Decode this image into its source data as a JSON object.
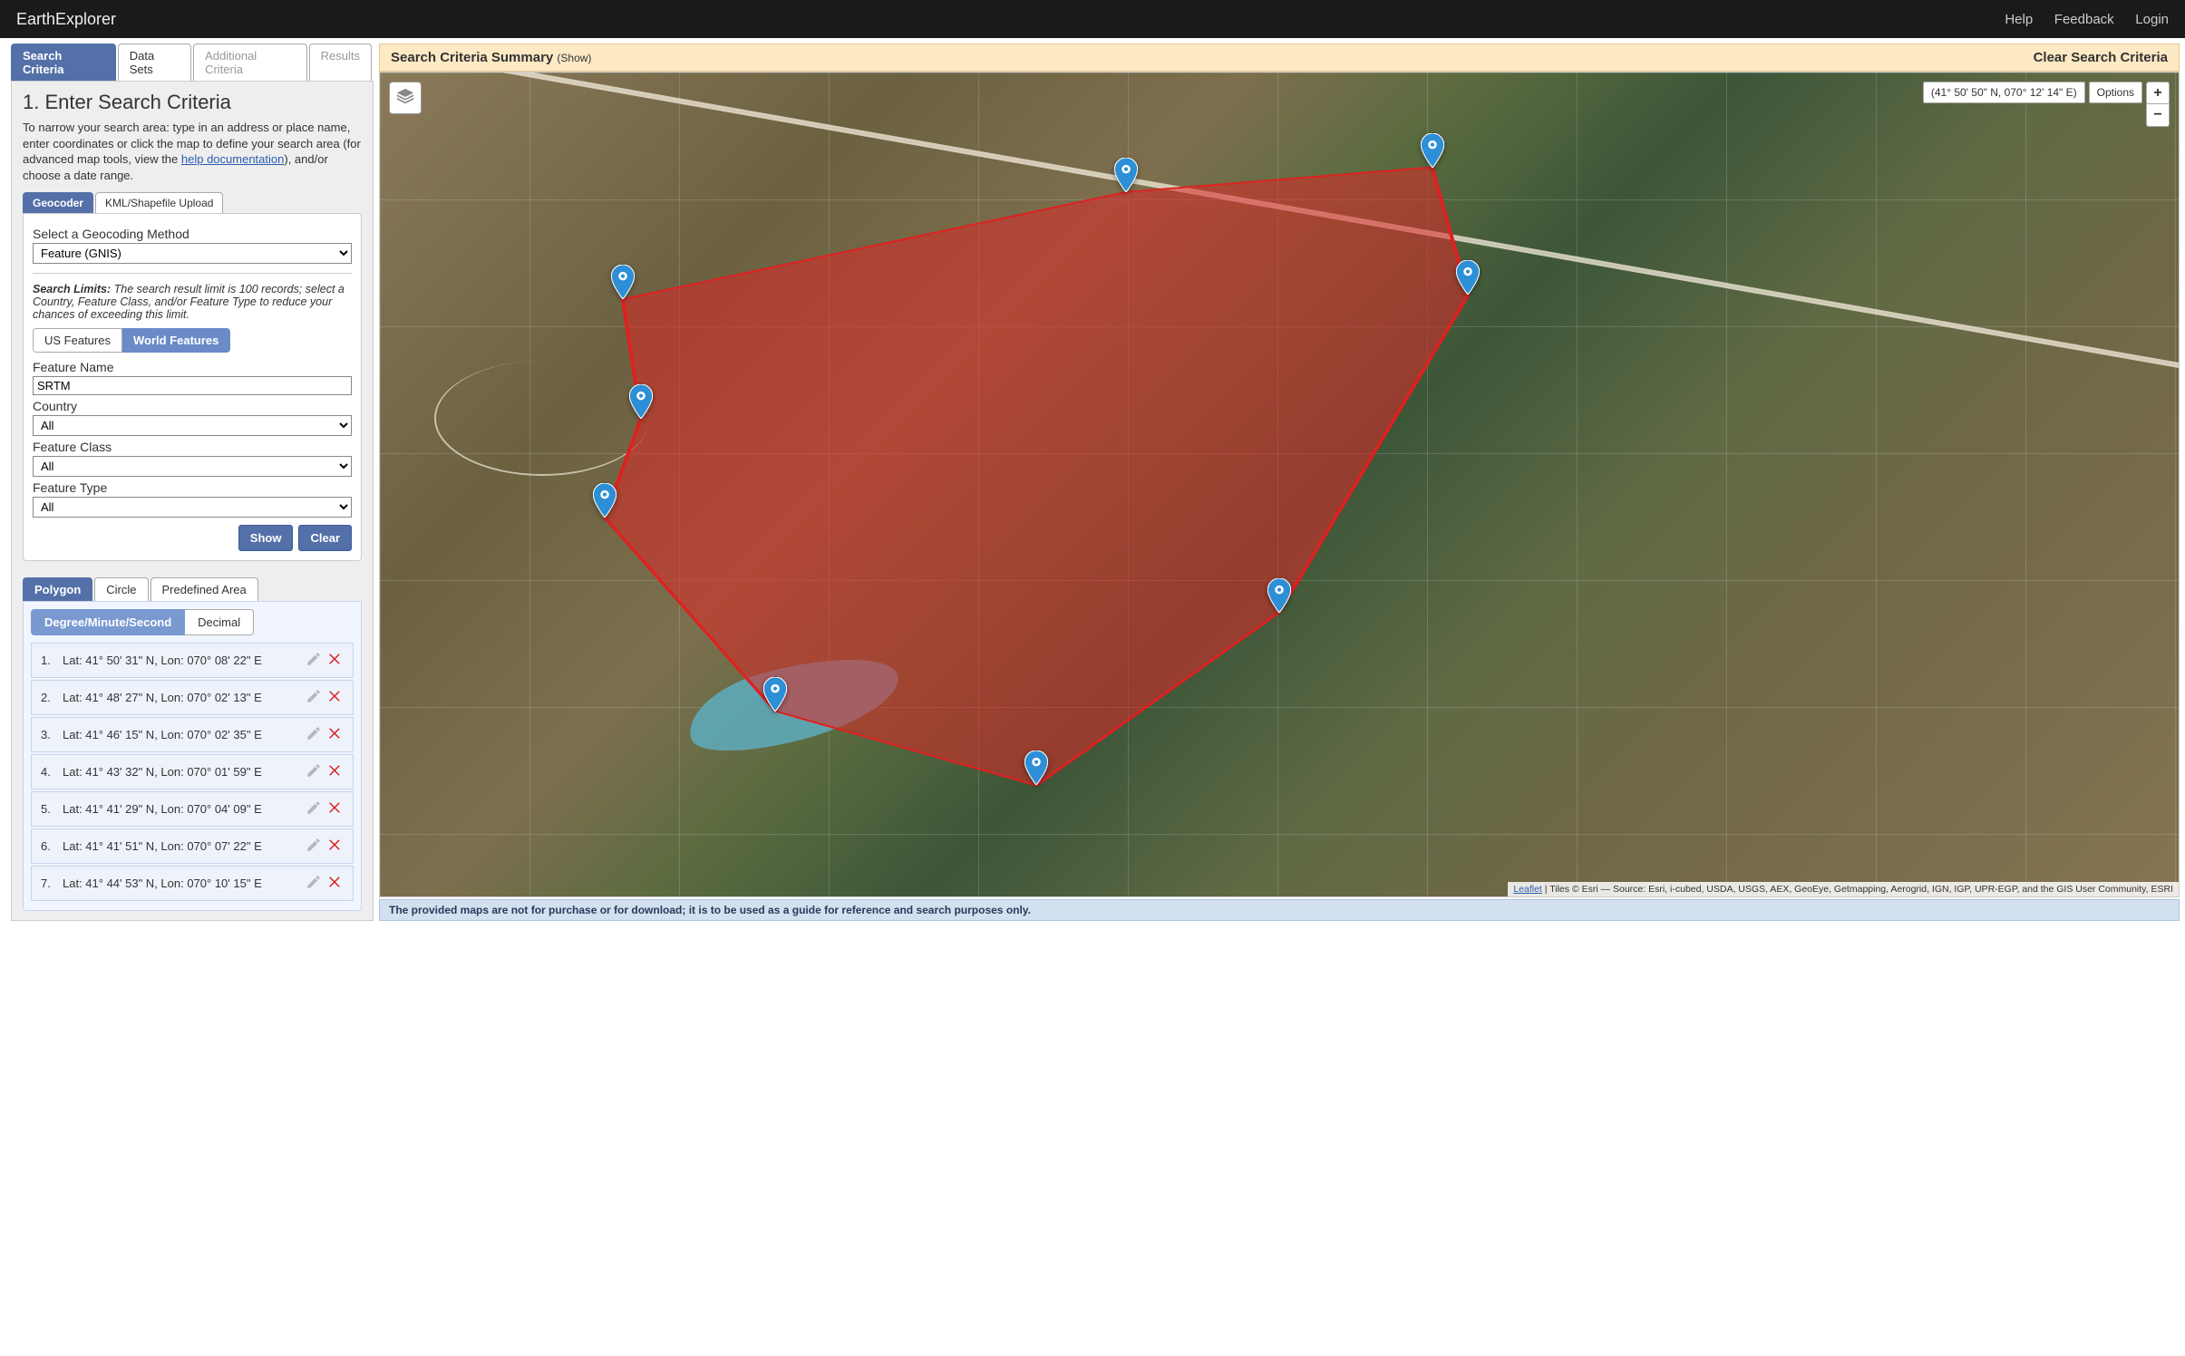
{
  "header": {
    "brand": "EarthExplorer",
    "links": {
      "help": "Help",
      "feedback": "Feedback",
      "login": "Login"
    }
  },
  "main_tabs": {
    "search_criteria": "Search Criteria",
    "data_sets": "Data Sets",
    "additional_criteria": "Additional Criteria",
    "results": "Results"
  },
  "criteria_panel": {
    "title": "1. Enter Search Criteria",
    "intro_a": "To narrow your search area: type in an address or place name, enter coordinates or click the map to define your search area (for advanced map tools, view the ",
    "intro_link": "help documentation",
    "intro_b": "), and/or choose a date range."
  },
  "geo_tabs": {
    "geocoder": "Geocoder",
    "upload": "KML/Shapefile Upload"
  },
  "geocoder": {
    "method_label": "Select a Geocoding Method",
    "method_value": "Feature (GNIS)",
    "limits_label": "Search Limits:",
    "limits_text": " The search result limit is 100 records; select a Country, Feature Class, and/or Feature Type to reduce your chances of exceeding this limit.",
    "feature_scope": {
      "us": "US Features",
      "world": "World Features"
    },
    "feature_name_label": "Feature Name",
    "feature_name_value": "SRTM",
    "country_label": "Country",
    "country_value": "All",
    "class_label": "Feature Class",
    "class_value": "All",
    "type_label": "Feature Type",
    "type_value": "All",
    "show_btn": "Show",
    "clear_btn": "Clear"
  },
  "area_tabs": {
    "polygon": "Polygon",
    "circle": "Circle",
    "predefined": "Predefined Area"
  },
  "format_tabs": {
    "dms": "Degree/Minute/Second",
    "decimal": "Decimal"
  },
  "coords": [
    {
      "n": "1.",
      "text": "Lat: 41° 50' 31\" N, Lon: 070° 08' 22\" E"
    },
    {
      "n": "2.",
      "text": "Lat: 41° 48' 27\" N, Lon: 070° 02' 13\" E"
    },
    {
      "n": "3.",
      "text": "Lat: 41° 46' 15\" N, Lon: 070° 02' 35\" E"
    },
    {
      "n": "4.",
      "text": "Lat: 41° 43' 32\" N, Lon: 070° 01' 59\" E"
    },
    {
      "n": "5.",
      "text": "Lat: 41° 41' 29\" N, Lon: 070° 04' 09\" E"
    },
    {
      "n": "6.",
      "text": "Lat: 41° 41' 51\" N, Lon: 070° 07' 22\" E"
    },
    {
      "n": "7.",
      "text": "Lat: 41° 44' 53\" N, Lon: 070° 10' 15\" E"
    }
  ],
  "summary": {
    "title": "Search Criteria Summary ",
    "show": "(Show)",
    "clear": "Clear Search Criteria"
  },
  "map": {
    "coord_display": "(41° 50' 50\" N, 070° 12' 14\" E)",
    "options": "Options",
    "attribution_link": "Leaflet",
    "attribution_rest": " | Tiles © Esri — Source: Esri, i-cubed, USDA, USGS, AEX, GeoEye, Getmapping, Aerogrid, IGN, IGP, UPR-EGP, and the GIS User Community, ESRI",
    "disclaimer": "The provided maps are not for purchase or for download; it is to be used as a guide for reference and search purposes only."
  },
  "polygon_points_pct": [
    [
      41.5,
      14.5
    ],
    [
      13.5,
      27.5
    ],
    [
      14.5,
      42.0
    ],
    [
      12.5,
      54.0
    ],
    [
      22.0,
      77.5
    ],
    [
      36.5,
      86.5
    ],
    [
      50.0,
      65.5
    ],
    [
      60.5,
      27.0
    ],
    [
      58.5,
      11.5
    ]
  ],
  "icons": {
    "zoom_in": "+",
    "zoom_out": "−"
  }
}
